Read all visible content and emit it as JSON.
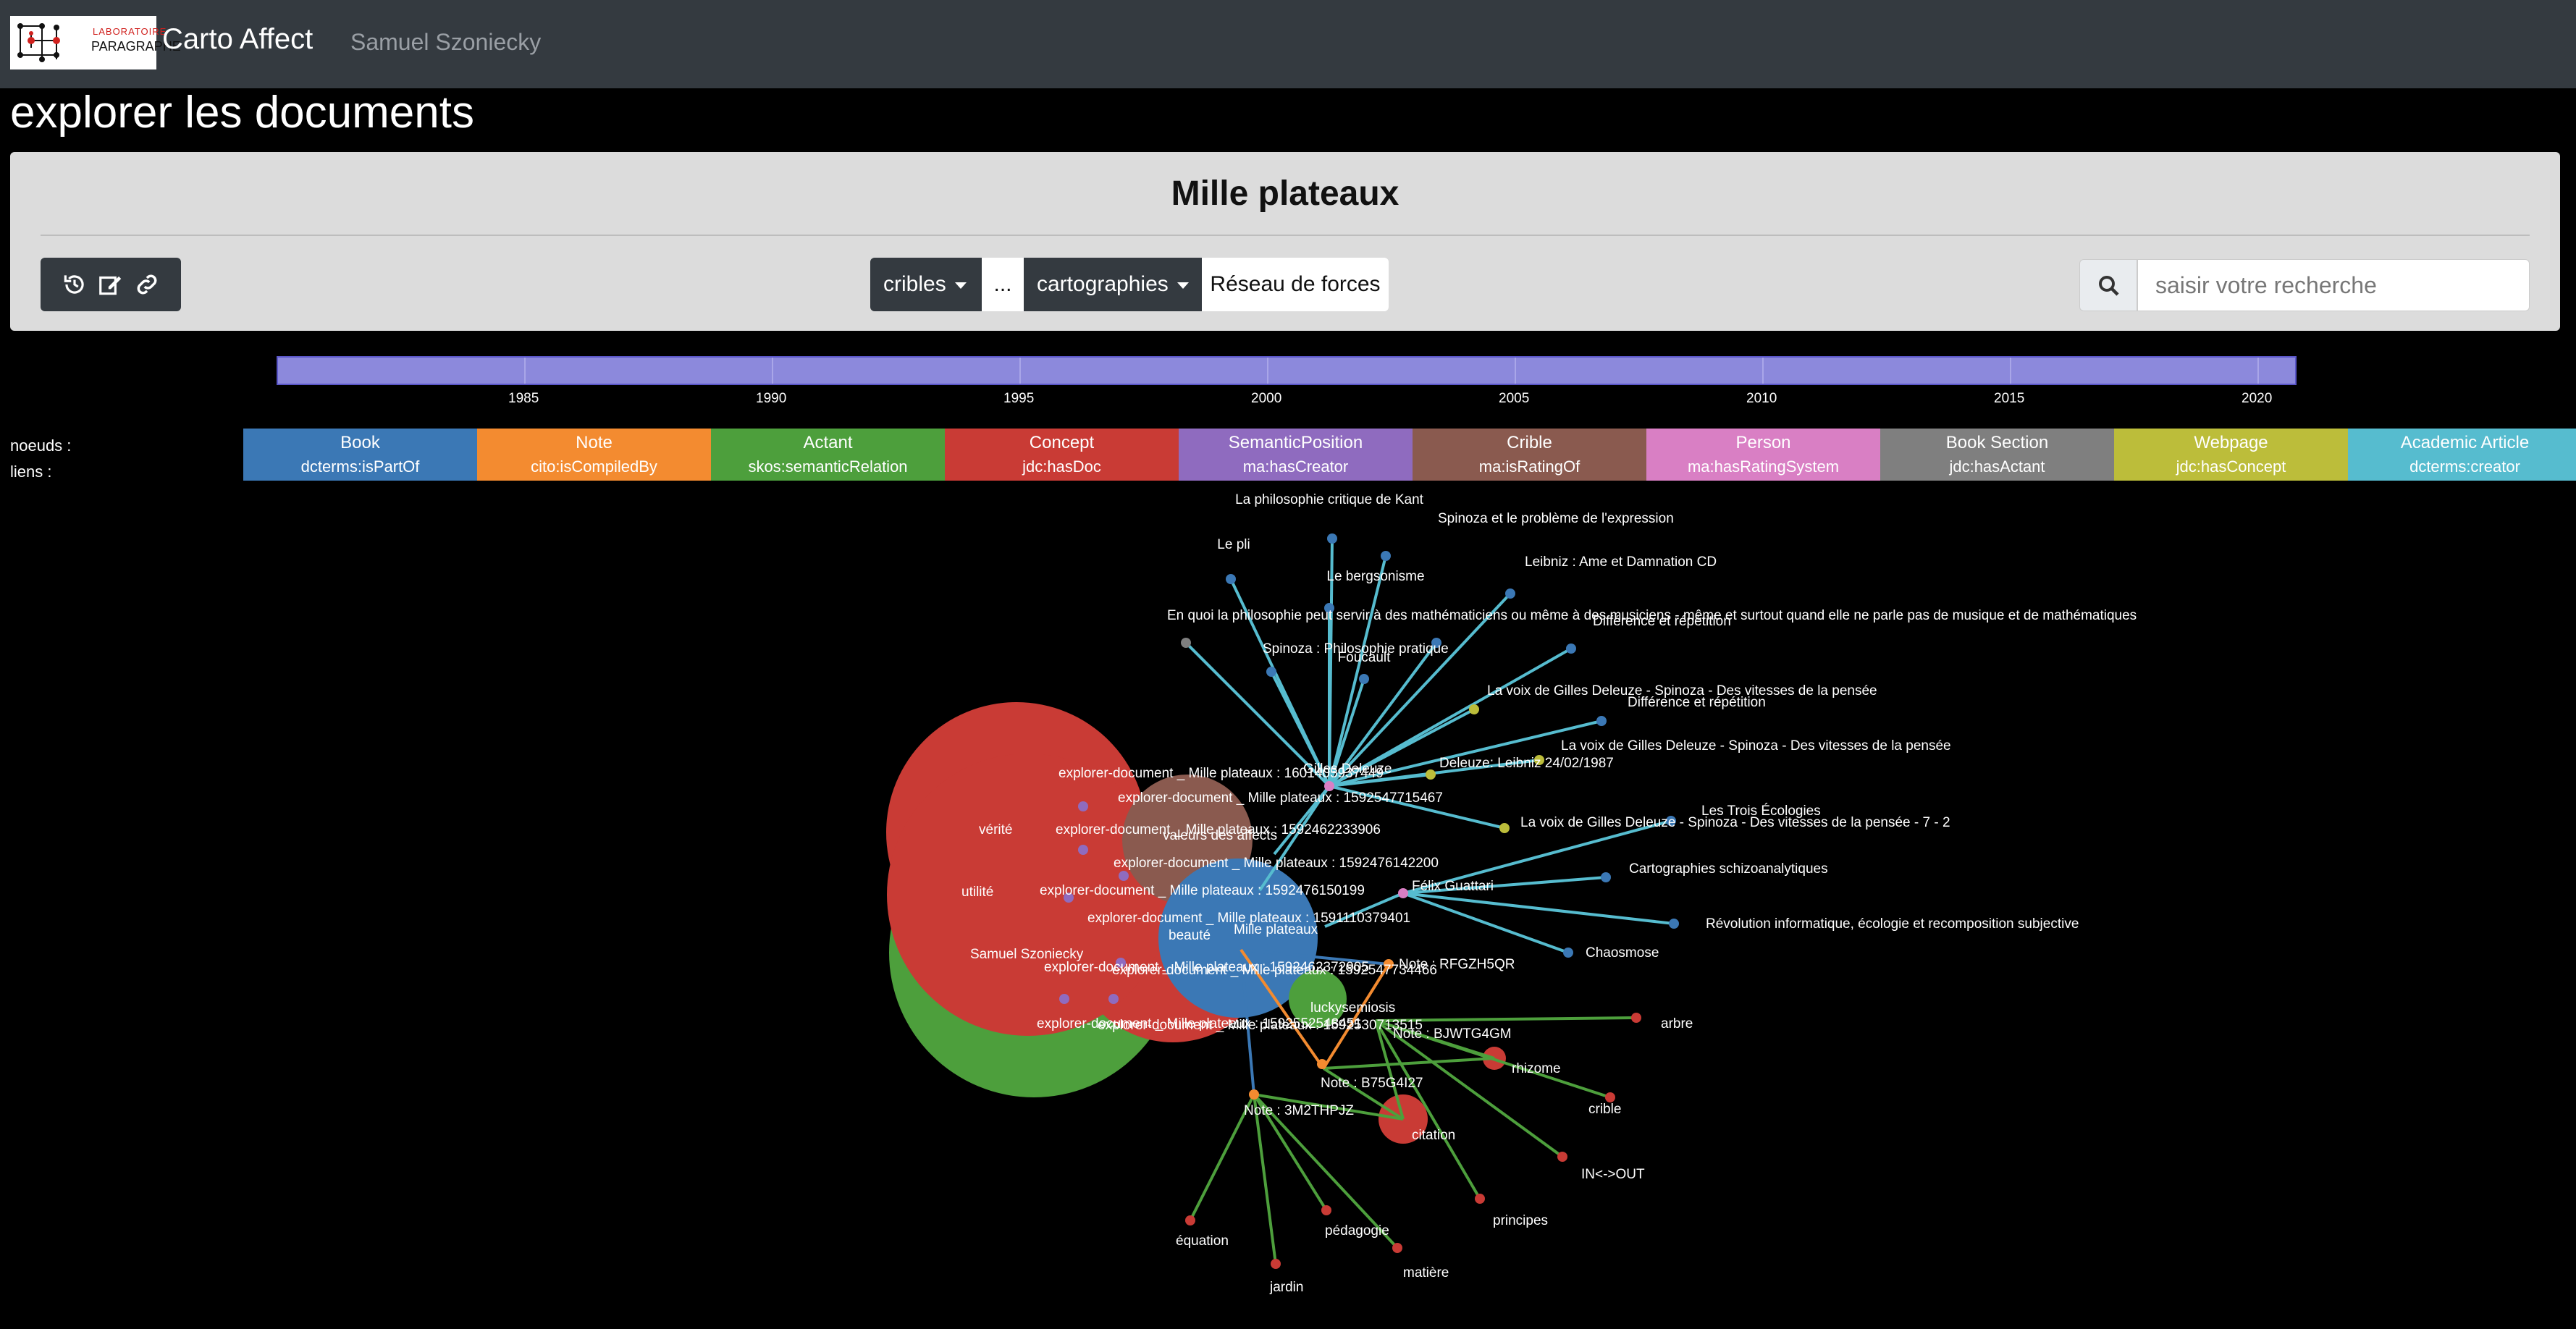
{
  "navbar": {
    "logo_top": "LABORATOIRE",
    "logo_bottom": "PARAGRAPHE",
    "brand": "Carto Affect",
    "user": "Samuel Szoniecky"
  },
  "page": {
    "title": "explorer les documents"
  },
  "card": {
    "doc_title": "Mille plateaux",
    "toolbar": {
      "icons": [
        "history-icon",
        "edit-icon",
        "link-icon"
      ]
    },
    "cribles_label": "cribles",
    "ellipsis_label": "...",
    "cartographies_label": "cartographies",
    "reseau_label": "Réseau de forces",
    "search_placeholder": "saisir votre recherche"
  },
  "timeline": {
    "ticks": [
      "1985",
      "1990",
      "1995",
      "2000",
      "2005",
      "2010",
      "2015",
      "2020"
    ]
  },
  "legend": {
    "nodes_label": "noeuds :",
    "links_label": "liens :",
    "items": [
      {
        "node": "Book",
        "link": "dcterms:isPartOf",
        "color": "#3b78b5"
      },
      {
        "node": "Note",
        "link": "cito:isCompiledBy",
        "color": "#f38b30"
      },
      {
        "node": "Actant",
        "link": "skos:semanticRelation",
        "color": "#4d9f3c"
      },
      {
        "node": "Concept",
        "link": "jdc:hasDoc",
        "color": "#c93b35"
      },
      {
        "node": "SemanticPosition",
        "link": "ma:hasCreator",
        "color": "#8f6bbf"
      },
      {
        "node": "Crible",
        "link": "ma:isRatingOf",
        "color": "#8a5a4f"
      },
      {
        "node": "Person",
        "link": "ma:hasRatingSystem",
        "color": "#d97fc4"
      },
      {
        "node": "Book Section",
        "link": "jdc:hasActant",
        "color": "#7f7f7f"
      },
      {
        "node": "Webpage",
        "link": "jdc:hasConcept",
        "color": "#bcbd3a"
      },
      {
        "node": "Academic Article",
        "link": "dcterms:creator",
        "color": "#56bccf"
      }
    ]
  },
  "graph": {
    "labels": [
      "La philosophie critique de Kant",
      "Spinoza et le problème de l'expression",
      "Le pli",
      "Le bergsonisme",
      "Leibniz : Ame et Damnation CD",
      "En quoi la philosophie peut servir à des mathématiciens ou même à des musiciens - même et surtout quand elle ne parle pas de musique et de mathématiques",
      "Différence et répétition",
      "Spinoza : Philosophie pratique",
      "Foucault",
      "La voix de Gilles Deleuze - Spinoza - Des vitesses de la pensée",
      "Différence et répétition",
      "La voix de Gilles Deleuze - Spinoza - Des vitesses de la pensée",
      "Deleuze: Leibniz 24/02/1987",
      "Gilles Deleuze",
      "La voix de Gilles Deleuze - Spinoza - Des vitesses de la pensée - 7 - 2",
      "Les Trois Écologies",
      "Cartographies schizoanalytiques",
      "Félix Guattari",
      "Révolution informatique, écologie et recomposition subjective",
      "Chaosmose",
      "explorer-document _ Mille plateaux : 1601405937449",
      "explorer-document _ Mille plateaux : 1592547715467",
      "vérité",
      "explorer-document _ Mille plateaux : 1592462233906",
      "valeurs des affects",
      "explorer-document _ Mille plateaux : 1592476142200",
      "utilité",
      "explorer-document _ Mille plateaux : 1592476150199",
      "explorer-document _ Mille plateaux : 1591110379401",
      "beauté",
      "Mille plateaux",
      "Samuel Szoniecky",
      "explorer-document _ Mille plateaux : 1592462372905",
      "explorer-document _ Mille plateaux : 1592547734466",
      "Note : RFGZH5QR",
      "luckysemiosis",
      "explorer-document _ Mille plateaux : 1592552548451",
      "explorer-document _ Mille plateaux : 1592530713515",
      "Note : BJWTG4GM",
      "arbre",
      "rhizome",
      "Note : B75G4I27",
      "crible",
      "Note : 3M2THPJZ",
      "citation",
      "IN<->OUT",
      "principes",
      "équation",
      "pédagogie",
      "matière",
      "jardin"
    ]
  }
}
